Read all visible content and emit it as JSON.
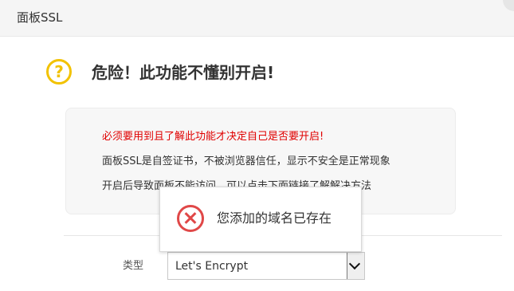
{
  "dialog": {
    "title": "面板SSL"
  },
  "warning": {
    "icon": "question-mark-icon",
    "title": "危险！此功能不懂别开启!"
  },
  "notice": {
    "line1": "必须要用到且了解此功能才决定自己是否要开启!",
    "line2": "面板SSL是自签证书，不被浏览器信任，显示不安全是正常现象",
    "line3": "开启后导致面板不能访问，可以点击下面链接了解解决方法"
  },
  "form": {
    "type_label": "类型",
    "type_value": "Let's Encrypt"
  },
  "toast": {
    "icon": "error-x-icon",
    "message": "您添加的域名已存在"
  },
  "colors": {
    "danger_text": "#e00000",
    "warning_icon": "#f2c200",
    "error_icon": "#e04848"
  }
}
